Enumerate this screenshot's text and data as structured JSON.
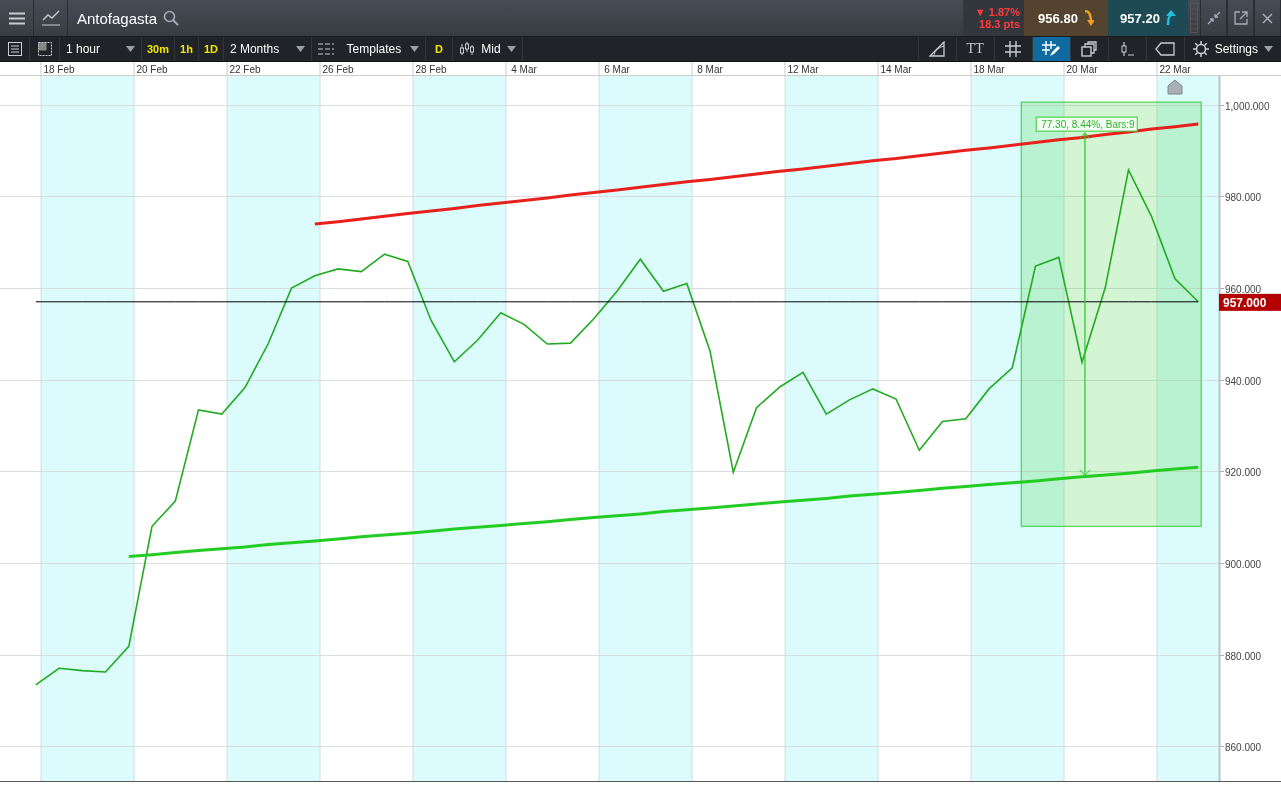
{
  "window": {
    "title": "Antofagasta"
  },
  "quote": {
    "change": "▼ 1.87%",
    "points": "18.3 pts",
    "sell": "956.80",
    "buy": "957.20"
  },
  "toolbar": {
    "interval": "1 hour",
    "quick_intervals": [
      {
        "label": "30m",
        "selected": false
      },
      {
        "label": "1h",
        "selected": false
      },
      {
        "label": "1D",
        "selected": false
      }
    ],
    "range": "2 Months",
    "templates": "Templates",
    "daily_label": "D",
    "price_type": "Mid",
    "tools": [
      {
        "kind": "draw",
        "selected": false
      },
      {
        "kind": "text",
        "label": "TT",
        "selected": false
      },
      {
        "kind": "grid",
        "selected": false
      },
      {
        "kind": "grid-draw",
        "selected": true
      },
      {
        "kind": "layers",
        "selected": false
      },
      {
        "kind": "candle",
        "selected": false
      },
      {
        "kind": "tag",
        "selected": false
      }
    ],
    "settings": "Settings"
  },
  "chart_data": {
    "type": "line",
    "ylim": [
      852.4,
      1006.3
    ],
    "grid": true,
    "categories": [
      null,
      "18 Feb",
      null,
      null,
      null,
      "20 Feb",
      null,
      null,
      null,
      "22 Feb",
      null,
      null,
      null,
      "26 Feb",
      null,
      null,
      null,
      "28 Feb",
      null,
      null,
      null,
      "4 Mar",
      null,
      null,
      null,
      "6 Mar",
      null,
      null,
      null,
      "8 Mar",
      null,
      null,
      null,
      "12 Mar",
      null,
      null,
      null,
      "14 Mar",
      null,
      null,
      null,
      "18 Mar",
      null,
      null,
      null,
      "20 Mar",
      null,
      null,
      null,
      "22 Mar",
      null
    ],
    "yticks": [
      {
        "value": 860,
        "label": "860.000"
      },
      {
        "value": 880,
        "label": "880.000"
      },
      {
        "value": 900,
        "label": "900.000"
      },
      {
        "value": 920,
        "label": "920.000"
      },
      {
        "value": 940,
        "label": "940.000"
      },
      {
        "value": 960,
        "label": "960.000"
      },
      {
        "value": 980,
        "label": "980.000"
      },
      {
        "value": 1000,
        "label": "1,000.000"
      }
    ],
    "series": [
      {
        "color": "#22aa22",
        "values": [
          873.4,
          877.0,
          876.5,
          876.2,
          881.8,
          908.0,
          913.5,
          933.4,
          932.5,
          938.3,
          947.9,
          960.0,
          962.7,
          964.2,
          963.6,
          967.4,
          965.8,
          953.0,
          943.9,
          948.6,
          954.6,
          952.1,
          947.8,
          948.0,
          953.3,
          959.3,
          966.3,
          959.3,
          961.0,
          946.3,
          919.8,
          933.9,
          938.4,
          941.6,
          932.5,
          935.6,
          938.0,
          935.8,
          924.6,
          930.9,
          931.5,
          938.0,
          942.6,
          964.8,
          966.7,
          943.8,
          960.1,
          985.8,
          975.5,
          962.0,
          957.0
        ]
      },
      {
        "color": "#e8201c",
        "values": [
          null,
          null,
          null,
          null,
          null,
          null,
          null,
          null,
          null,
          null,
          null,
          null,
          974.0,
          974.5,
          975.1,
          975.7,
          976.3,
          976.8,
          977.4,
          978.0,
          978.6,
          979.1,
          979.7,
          980.3,
          980.9,
          981.4,
          982.0,
          982.6,
          983.2,
          983.7,
          984.3,
          984.9,
          985.5,
          986.0,
          986.6,
          987.2,
          987.8,
          988.3,
          988.9,
          989.5,
          990.1,
          990.6,
          991.2,
          991.8,
          992.4,
          992.9,
          993.5,
          994.1,
          994.7,
          995.2,
          995.8
        ]
      },
      {
        "color": "#22cc22",
        "values": [
          null,
          null,
          null,
          null,
          901.4,
          901.8,
          902.3,
          902.7,
          903.1,
          903.5,
          904.0,
          904.4,
          904.8,
          905.2,
          905.7,
          906.1,
          906.5,
          906.9,
          907.4,
          907.8,
          908.2,
          908.6,
          909.0,
          909.5,
          909.9,
          910.3,
          910.7,
          911.2,
          911.6,
          912.0,
          912.4,
          912.9,
          913.3,
          913.7,
          914.1,
          914.6,
          915.0,
          915.4,
          915.8,
          916.3,
          916.7,
          917.1,
          917.5,
          917.9,
          918.4,
          918.8,
          919.2,
          919.6,
          920.1,
          920.5,
          920.9
        ]
      },
      {
        "color": "#000000",
        "values": [
          957.0,
          957.0,
          957.0,
          957.0,
          957.0,
          957.0,
          957.0,
          957.0,
          957.0,
          957.0,
          957.0,
          957.0,
          957.0,
          957.0,
          957.0,
          957.0,
          957.0,
          957.0,
          957.0,
          957.0,
          957.0,
          957.0,
          957.0,
          957.0,
          957.0,
          957.0,
          957.0,
          957.0,
          957.0,
          957.0,
          957.0,
          957.0,
          957.0,
          957.0,
          957.0,
          957.0,
          957.0,
          957.0,
          957.0,
          957.0,
          957.0,
          957.0,
          957.0,
          957.0,
          957.0,
          957.0,
          957.0,
          957.0,
          957.0,
          957.0,
          957.0
        ]
      }
    ]
  },
  "measurement": {
    "label": "77.30, 8.44%, Bars:9"
  },
  "current_price": {
    "label": "957.000"
  }
}
